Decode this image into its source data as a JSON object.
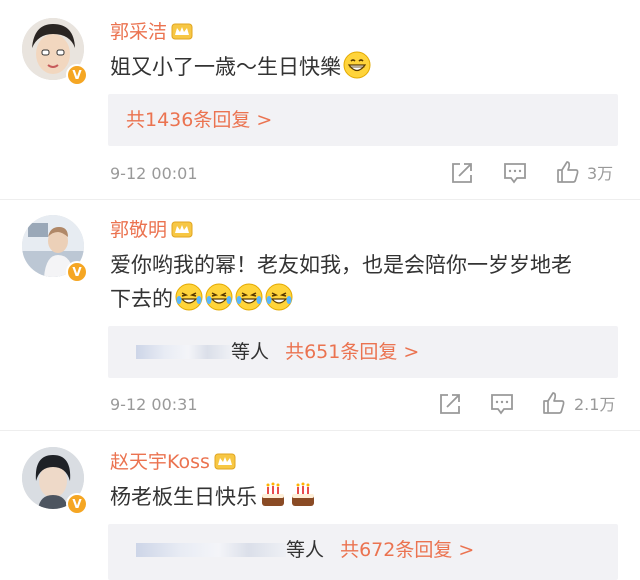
{
  "comments": [
    {
      "name": "郭采洁",
      "text": "姐又小了一歳～生日快樂",
      "emoji": [
        "grin-emoji"
      ],
      "replies": {
        "prefix": "",
        "label": "共1436条回复 >"
      },
      "time": "9-12 00:01",
      "likes": "3万"
    },
    {
      "name": "郭敬明",
      "text_line1": "爱你哟我的幂！老友如我，也是会陪你一岁岁地老",
      "text_line2": "下去的",
      "emoji": [
        "laugh-cry-emoji",
        "laugh-cry-emoji",
        "laugh-cry-emoji",
        "laugh-cry-emoji"
      ],
      "replies": {
        "prefix": "等人",
        "label": "共651条回复 >"
      },
      "time": "9-12 00:31",
      "likes": "2.1万"
    },
    {
      "name": "赵天宇Koss",
      "text": "杨老板生日快乐",
      "emoji": [
        "cake-emoji",
        "cake-emoji"
      ],
      "replies": {
        "prefix": "等人",
        "label": "共672条回复 >"
      }
    }
  ],
  "colors": {
    "name": "#eb7350",
    "link": "#eb7350",
    "meta": "#999999",
    "badge": "#f5a623",
    "reply_bg": "#f2f2f5"
  }
}
